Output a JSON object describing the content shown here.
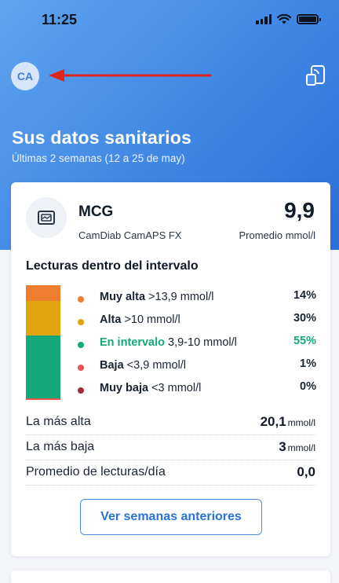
{
  "status_bar": {
    "time": "11:25"
  },
  "header": {
    "avatar_initials": "CA",
    "title": "Sus datos sanitarios",
    "subtitle": "Últimas 2 semanas (12 a 25 de may)"
  },
  "cgm_card": {
    "title": "MCG",
    "device": "CamDiab CamAPS FX",
    "average_value": "9,9",
    "average_label": "Promedio mmol/l",
    "section_title": "Lecturas dentro del intervalo",
    "ranges": [
      {
        "name": "Muy alta",
        "threshold": ">13,9 mmol/l",
        "percent": "14%",
        "color": "#ef7d2f"
      },
      {
        "name": "Alta",
        "threshold": ">10 mmol/l",
        "percent": "30%",
        "color": "#e2a40c"
      },
      {
        "name": "En intervalo",
        "threshold": "3,9-10 mmol/l",
        "percent": "55%",
        "color": "#13a97a"
      },
      {
        "name": "Baja",
        "threshold": "<3,9 mmol/l",
        "percent": "1%",
        "color": "#ee5252"
      },
      {
        "name": "Muy baja",
        "threshold": "<3 mmol/l",
        "percent": "0%",
        "color": "#a52a3a"
      }
    ],
    "stats": [
      {
        "label": "La más alta",
        "value": "20,1",
        "unit": "mmol/l"
      },
      {
        "label": "La más baja",
        "value": "3",
        "unit": "mmol/l"
      },
      {
        "label": "Promedio de lecturas/día",
        "value": "0,0",
        "unit": ""
      }
    ],
    "previous_weeks_button": "Ver semanas anteriores"
  }
}
